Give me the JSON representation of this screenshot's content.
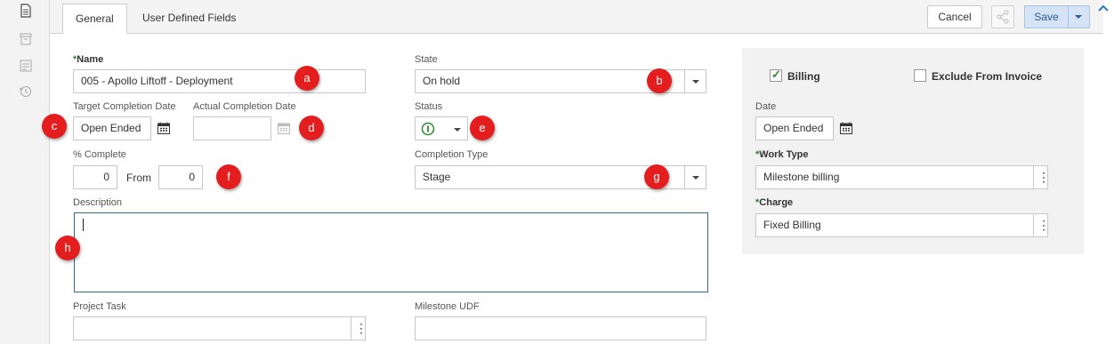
{
  "tabs": [
    {
      "label": "General",
      "active": true
    },
    {
      "label": "User Defined Fields",
      "active": false
    }
  ],
  "toolbar": {
    "cancel_label": "Cancel",
    "save_label": "Save"
  },
  "form": {
    "name": {
      "label": "Name",
      "value": "005 - Apollo Liftoff - Deployment",
      "required": true
    },
    "state": {
      "label": "State",
      "value": "On hold"
    },
    "target_completion": {
      "label": "Target Completion Date",
      "value": "Open Ended"
    },
    "actual_completion": {
      "label": "Actual Completion Date",
      "value": ""
    },
    "status": {
      "label": "Status",
      "icon": "status-circle-icon",
      "color": "#2d8a2d"
    },
    "percent_complete": {
      "label": "% Complete",
      "value": "0",
      "from_label": "From",
      "from_value": "0"
    },
    "completion_type": {
      "label": "Completion Type",
      "value": "Stage"
    },
    "description": {
      "label": "Description",
      "value": ""
    },
    "project_task": {
      "label": "Project Task",
      "value": ""
    },
    "milestone_udf": {
      "label": "Milestone UDF",
      "value": ""
    }
  },
  "billing_panel": {
    "billing": {
      "label": "Billing",
      "checked": true
    },
    "exclude_from_invoice": {
      "label": "Exclude From Invoice",
      "checked": false
    },
    "date": {
      "label": "Date",
      "value": "Open Ended"
    },
    "work_type": {
      "label": "Work Type",
      "value": "Milestone billing",
      "required": true
    },
    "charge": {
      "label": "Charge",
      "value": "Fixed Billing",
      "required": true
    }
  },
  "markers": [
    "a",
    "b",
    "c",
    "d",
    "e",
    "f",
    "g",
    "h"
  ],
  "colors": {
    "marker": "#e41e1e",
    "accent": "#2a5b91",
    "required_star": "#2d8a2d"
  }
}
